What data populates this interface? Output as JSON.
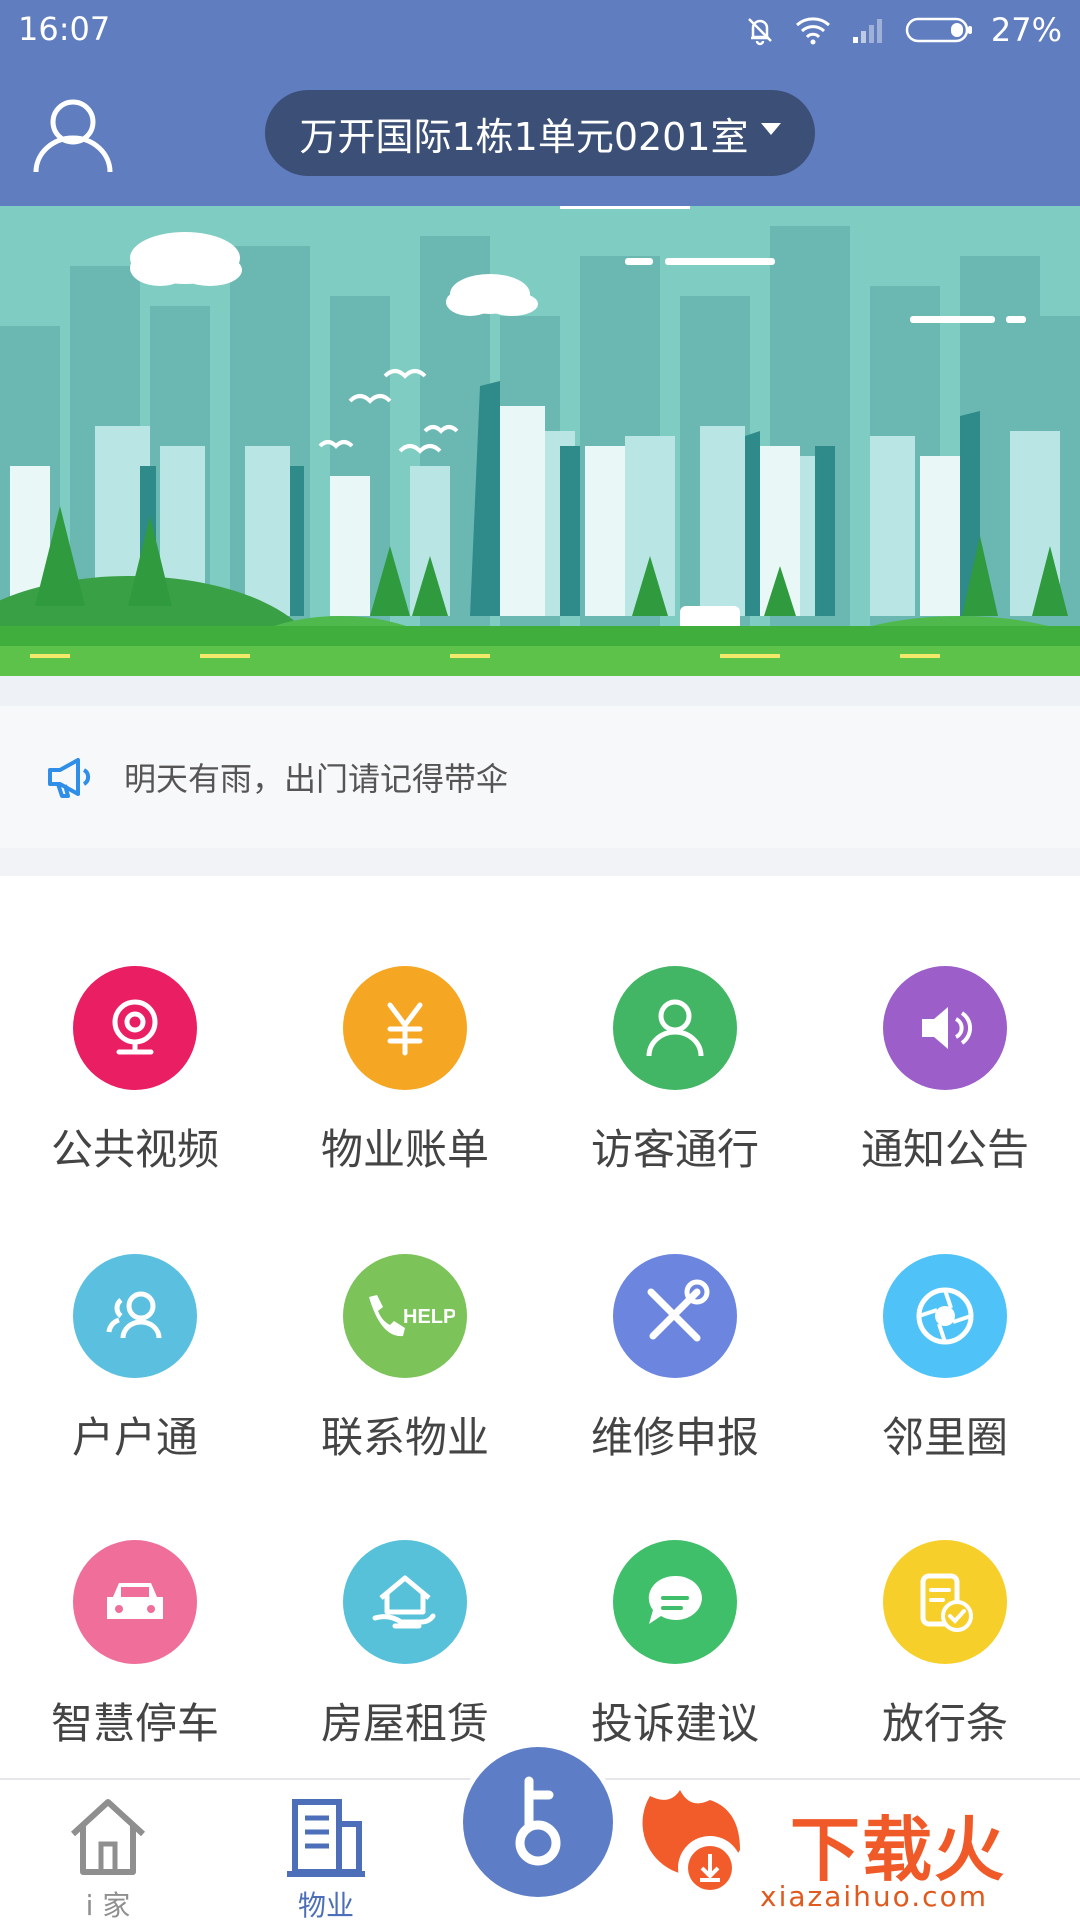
{
  "status_bar": {
    "time": "16:07",
    "battery": "27%"
  },
  "header": {
    "address": "万开国际1栋1单元0201室"
  },
  "notice": {
    "text": "明天有雨，出门请记得带伞"
  },
  "grid": {
    "items": [
      {
        "label": "公共视频",
        "icon": "camera-icon",
        "color": "#e91e63"
      },
      {
        "label": "物业账单",
        "icon": "yuan-icon",
        "color": "#f5a623"
      },
      {
        "label": "访客通行",
        "icon": "visitor-icon",
        "color": "#43b665"
      },
      {
        "label": "通知公告",
        "icon": "speaker-icon",
        "color": "#9c5ec9"
      },
      {
        "label": "户户通",
        "icon": "neighbors-icon",
        "color": "#5bbfe0"
      },
      {
        "label": "联系物业",
        "icon": "help-phone-icon",
        "color": "#7cc35a"
      },
      {
        "label": "维修申报",
        "icon": "repair-tools-icon",
        "color": "#6c86e0"
      },
      {
        "label": "邻里圈",
        "icon": "aperture-icon",
        "color": "#4fc3f7"
      },
      {
        "label": "智慧停车",
        "icon": "car-icon",
        "color": "#ef6f9a"
      },
      {
        "label": "房屋租赁",
        "icon": "house-rent-icon",
        "color": "#56c1d9"
      },
      {
        "label": "投诉建议",
        "icon": "chat-icon",
        "color": "#3fbf6a"
      },
      {
        "label": "放行条",
        "icon": "pass-slip-icon",
        "color": "#f6cf2a"
      }
    ]
  },
  "bottom_nav": {
    "home": "i 家",
    "property": "物业"
  },
  "watermark": {
    "title": "下载火",
    "subtitle": "xiazaihuo.com"
  }
}
